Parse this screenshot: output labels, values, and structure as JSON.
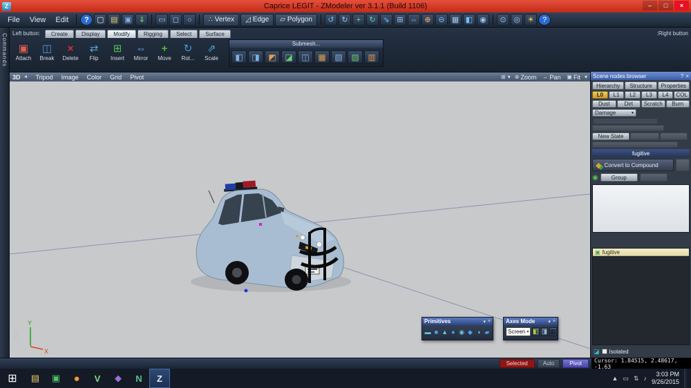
{
  "window": {
    "title": "Caprice LEGIT - ZModeler ver 3.1.1 (Build 1106)",
    "app_icon_glyph": "Z",
    "minimize_glyph": "–",
    "maximize_glyph": "□",
    "close_glyph": "×"
  },
  "ui": {
    "dropdown_glyph": "▾"
  },
  "menubar": {
    "menus": [
      "File",
      "View",
      "Edit"
    ],
    "left_icons": [
      {
        "name": "help-icon",
        "glyph": "?"
      },
      {
        "name": "new-file-icon",
        "glyph": "▢"
      },
      {
        "name": "open-file-icon",
        "glyph": "▤"
      },
      {
        "name": "save-file-icon",
        "glyph": "▣"
      },
      {
        "name": "import-icon",
        "glyph": "⇓"
      }
    ],
    "select_icons": [
      {
        "name": "select-single-icon",
        "glyph": "▭"
      },
      {
        "name": "select-rect-icon",
        "glyph": "◻"
      },
      {
        "name": "select-circle-icon",
        "glyph": "○"
      }
    ],
    "mode_buttons": [
      {
        "label": "Vertex",
        "glyph": "∴"
      },
      {
        "label": "Edge",
        "glyph": "◿"
      },
      {
        "label": "Polygon",
        "glyph": "▱"
      }
    ],
    "right_icons": [
      {
        "name": "undo-icon",
        "glyph": "↺"
      },
      {
        "name": "redo-icon",
        "glyph": "↻"
      },
      {
        "name": "move-gizmo-icon",
        "glyph": "+"
      },
      {
        "name": "rotate-gizmo-icon",
        "glyph": "↻"
      },
      {
        "name": "scale-gizmo-icon",
        "glyph": "⇘"
      },
      {
        "name": "snap-grid-icon",
        "glyph": "⊞"
      },
      {
        "name": "mirror-tool-icon",
        "glyph": "⇔"
      },
      {
        "name": "weld-tool-icon",
        "glyph": "⊕"
      },
      {
        "name": "detach-tool-icon",
        "glyph": "⊖"
      },
      {
        "name": "wireframe-icon",
        "glyph": "▦"
      },
      {
        "name": "shaded-view-icon",
        "glyph": "◧"
      },
      {
        "name": "render-icon",
        "glyph": "◉"
      }
    ],
    "far_icons": [
      {
        "name": "settings-icon",
        "glyph": "⊙"
      },
      {
        "name": "camera-icon",
        "glyph": "◎"
      },
      {
        "name": "light-icon",
        "glyph": "☀"
      },
      {
        "name": "about-icon",
        "glyph": "?"
      }
    ]
  },
  "ribbon": {
    "left_label": "Left button:",
    "right_label": ":Right button",
    "tabs": [
      "Create",
      "Display",
      "Modify",
      "Rigging",
      "Select",
      "Surface"
    ],
    "active_tab": "Modify",
    "tools": [
      {
        "label": "Attach",
        "glyph": "▣"
      },
      {
        "label": "Break",
        "glyph": "◫"
      },
      {
        "label": "Delete",
        "glyph": "×"
      },
      {
        "label": "Flip",
        "glyph": "⇄"
      },
      {
        "label": "Insert",
        "glyph": "⊞"
      },
      {
        "label": "Mirror",
        "glyph": "⇔"
      },
      {
        "label": "Move",
        "glyph": "+"
      },
      {
        "label": "Rot...",
        "glyph": "↻"
      },
      {
        "label": "Scale",
        "glyph": "⇗"
      }
    ],
    "submesh": {
      "title": "Submesh...",
      "icons": [
        {
          "name": "submesh-box-icon",
          "glyph": "◧"
        },
        {
          "name": "submesh-extrude-icon",
          "glyph": "◨"
        },
        {
          "name": "submesh-inset-icon",
          "glyph": "◩"
        },
        {
          "name": "submesh-bevel-icon",
          "glyph": "◪"
        },
        {
          "name": "submesh-bridge-icon",
          "glyph": "◫"
        },
        {
          "name": "submesh-weld-icon",
          "glyph": "▦"
        },
        {
          "name": "submesh-split-icon",
          "glyph": "▧"
        },
        {
          "name": "submesh-detach-icon",
          "glyph": "▨"
        },
        {
          "name": "submesh-cap-icon",
          "glyph": "▥"
        }
      ]
    }
  },
  "commands_strip": {
    "label": "Commands"
  },
  "viewport": {
    "label": "3D",
    "back_glyph": "◄",
    "menu": [
      "Tripod",
      "Image",
      "Color",
      "Grid",
      "Pivot"
    ],
    "corner_icons": [
      {
        "name": "viewport-grid-icon",
        "glyph": "⊞"
      },
      {
        "name": "viewport-views-dropdown-icon",
        "glyph": "▾"
      }
    ],
    "zoom": {
      "label": "Zoom",
      "glyph": "⊕"
    },
    "pan": {
      "label": "Pan",
      "glyph": "↔"
    },
    "fit": {
      "label": "Fit",
      "glyph": "▣"
    },
    "axis_labels": {
      "x": "X",
      "y": "Y",
      "z": "Z"
    }
  },
  "primitives_panel": {
    "title": "Primitives",
    "buttons": [
      {
        "name": "collapse-icon",
        "glyph": "▾"
      },
      {
        "name": "close-icon",
        "glyph": "×"
      }
    ],
    "icons": [
      {
        "name": "primitive-plane-icon",
        "glyph": "▬"
      },
      {
        "name": "primitive-box-icon",
        "glyph": "■"
      },
      {
        "name": "primitive-cone-icon",
        "glyph": "▲"
      },
      {
        "name": "primitive-sphere-icon",
        "glyph": "●"
      },
      {
        "name": "primitive-torus-icon",
        "glyph": "◉"
      },
      {
        "name": "primitive-cylinder-icon",
        "glyph": "◆"
      },
      {
        "name": "primitive-disc-icon",
        "glyph": "◑"
      },
      {
        "name": "primitive-strip-icon",
        "glyph": "▰"
      }
    ]
  },
  "axes_panel": {
    "title": "Axes Mode",
    "buttons": [
      {
        "name": "collapse-icon",
        "glyph": "▾"
      },
      {
        "name": "close-icon",
        "glyph": "×"
      }
    ],
    "dropdown_value": "Screen",
    "axis_buttons": [
      {
        "name": "axis-x-button",
        "glyph": "◧"
      },
      {
        "name": "axis-y-button",
        "glyph": "◨"
      },
      {
        "name": "axis-z-button",
        "glyph": "▥"
      }
    ]
  },
  "scene_browser": {
    "title": "Scene nodes browser",
    "header_buttons": [
      {
        "name": "panel-help-icon",
        "glyph": "?"
      },
      {
        "name": "panel-close-icon",
        "glyph": "×"
      }
    ],
    "tabs": [
      "Hierarchy",
      "Structure",
      "Properties"
    ],
    "lod_buttons": [
      "L0",
      "L1",
      "L2",
      "L3",
      "L4",
      "COL"
    ],
    "active_lod": "L0",
    "damage_buttons": [
      "Dust",
      "Dirt",
      "Scratch",
      "Burn"
    ],
    "damage_dropdown": "Damage",
    "new_state_button": "New State",
    "selected_node": "fugitive",
    "convert_button": "Convert to Compound",
    "group_button": "Group",
    "list_item": "fugitive",
    "isolated_label": "Isolated"
  },
  "status_bar": {
    "selected_badge": "Selected",
    "auto_button": "Auto",
    "pivot_badge": "Pivot",
    "cursor_readout": "Cursor: 1.84515, 2.48617, -1.63"
  },
  "taskbar": {
    "start_glyph": "⊞",
    "apps": [
      {
        "name": "file-explorer-icon",
        "glyph": "▤"
      },
      {
        "name": "store-icon",
        "glyph": "▣"
      },
      {
        "name": "firefox-icon",
        "glyph": "●"
      },
      {
        "name": "app-v-icon",
        "glyph": "V"
      },
      {
        "name": "visual-studio-icon",
        "glyph": "◆"
      },
      {
        "name": "app-n-icon",
        "glyph": "N"
      },
      {
        "name": "zmodeler-taskbar-icon",
        "glyph": "Z"
      }
    ],
    "tray_icons": [
      {
        "name": "show-hidden-icons",
        "glyph": "▲"
      },
      {
        "name": "action-center-icon",
        "glyph": "▭"
      },
      {
        "name": "network-icon",
        "glyph": "⇅"
      },
      {
        "name": "volume-icon",
        "glyph": "♪"
      }
    ],
    "time": "3:03 PM",
    "date": "9/26/2015"
  }
}
